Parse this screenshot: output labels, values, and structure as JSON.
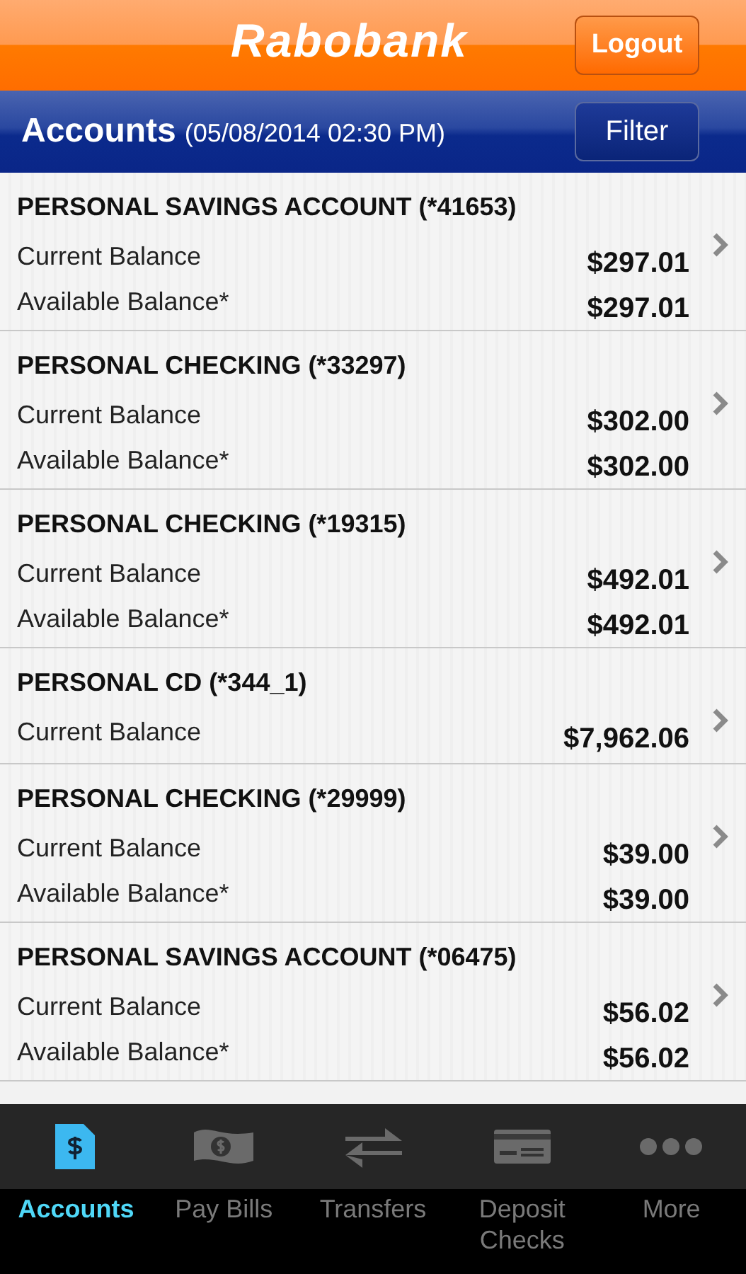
{
  "header": {
    "logo": "Rabobank",
    "logout": "Logout"
  },
  "subbar": {
    "title": "Accounts",
    "timestamp": "(05/08/2014 02:30 PM)",
    "filter": "Filter"
  },
  "accounts": [
    {
      "name": "PERSONAL SAVINGS ACCOUNT (*41653)",
      "balances": [
        {
          "label": "Current Balance",
          "amount": "$297.01"
        },
        {
          "label": "Available Balance*",
          "amount": "$297.01"
        }
      ]
    },
    {
      "name": "PERSONAL CHECKING (*33297)",
      "balances": [
        {
          "label": "Current Balance",
          "amount": "$302.00"
        },
        {
          "label": "Available Balance*",
          "amount": "$302.00"
        }
      ]
    },
    {
      "name": "PERSONAL CHECKING (*19315)",
      "balances": [
        {
          "label": "Current Balance",
          "amount": "$492.01"
        },
        {
          "label": "Available Balance*",
          "amount": "$492.01"
        }
      ]
    },
    {
      "name": "PERSONAL CD (*344_1)",
      "balances": [
        {
          "label": "Current Balance",
          "amount": "$7,962.06"
        }
      ]
    },
    {
      "name": "PERSONAL CHECKING (*29999)",
      "balances": [
        {
          "label": "Current Balance",
          "amount": "$39.00"
        },
        {
          "label": "Available Balance*",
          "amount": "$39.00"
        }
      ]
    },
    {
      "name": "PERSONAL SAVINGS ACCOUNT (*06475)",
      "balances": [
        {
          "label": "Current Balance",
          "amount": "$56.02"
        },
        {
          "label": "Available Balance*",
          "amount": "$56.02"
        }
      ]
    }
  ],
  "tabs": [
    {
      "label": "Accounts",
      "selected": true
    },
    {
      "label": "Pay Bills",
      "selected": false
    },
    {
      "label": "Transfers",
      "selected": false
    },
    {
      "label": "Deposit Checks",
      "selected": false
    },
    {
      "label": "More",
      "selected": false
    }
  ]
}
